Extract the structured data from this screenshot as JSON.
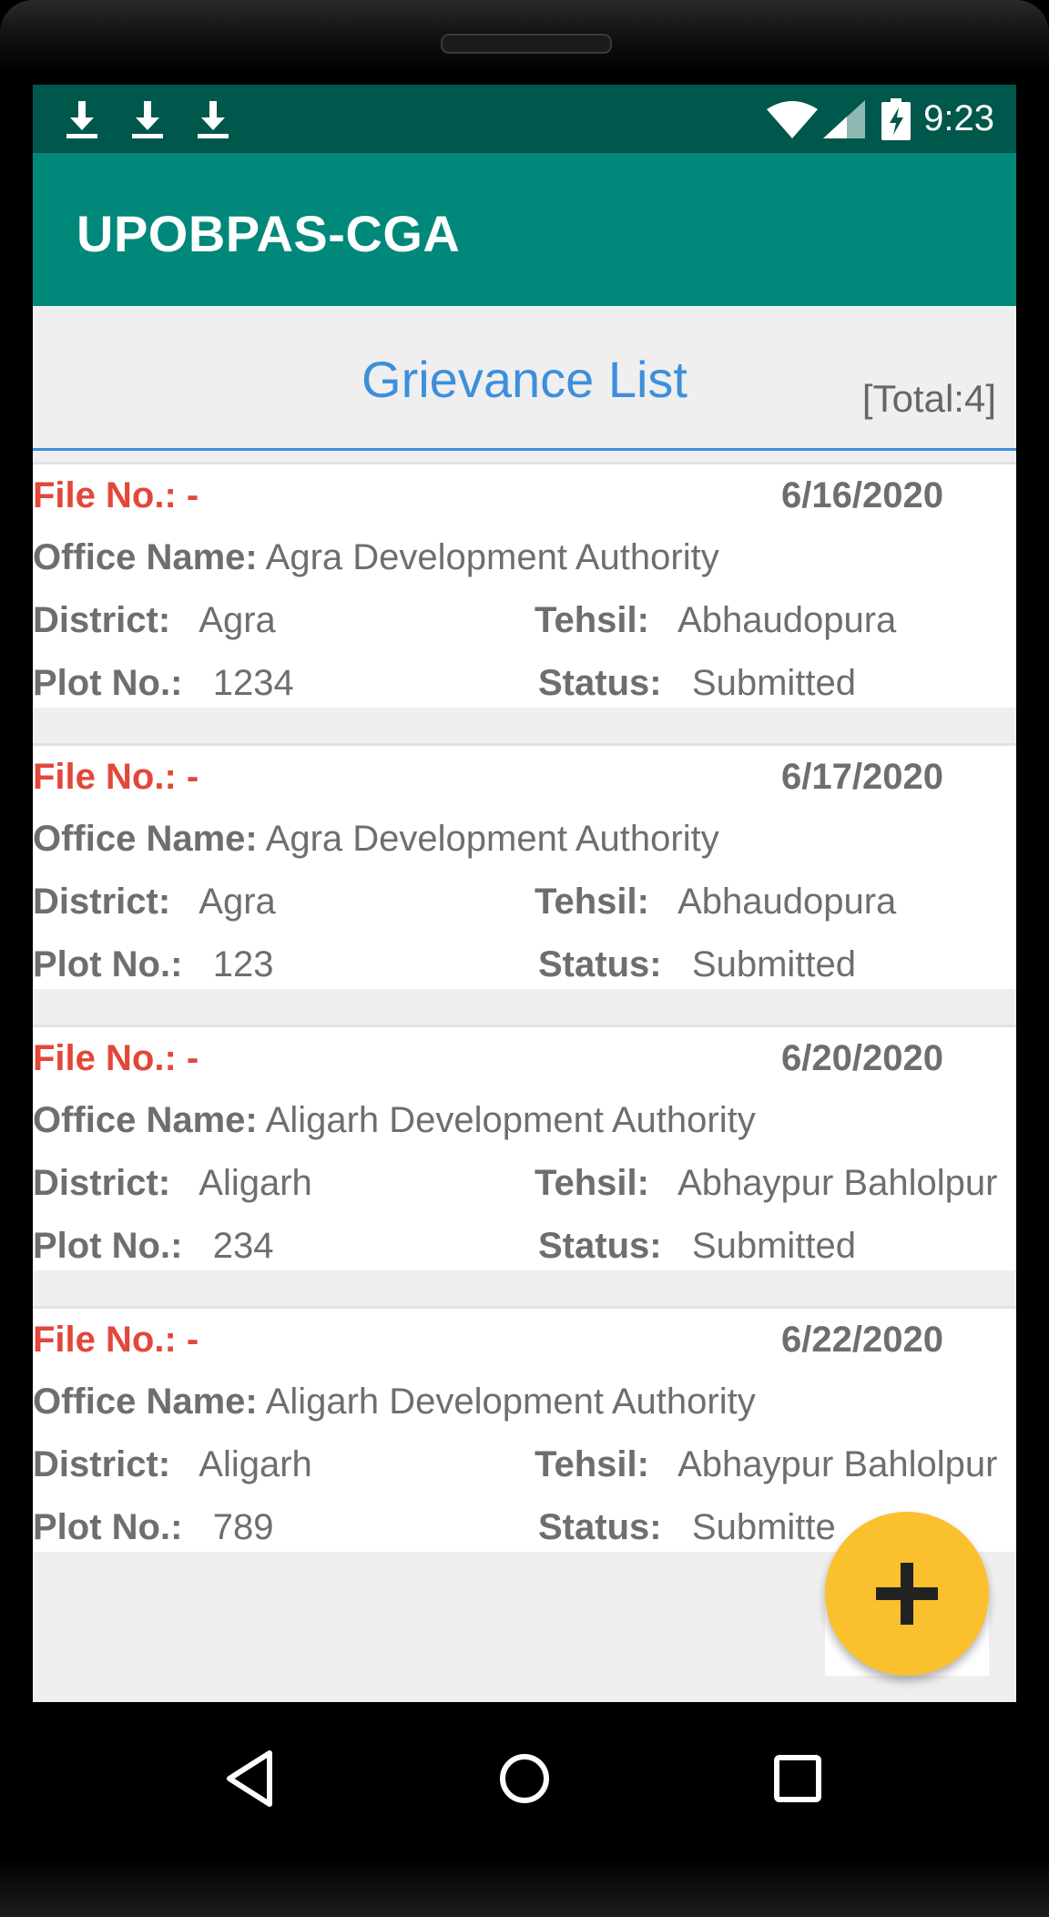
{
  "status_bar": {
    "time": "9:23",
    "icons": [
      "download-icon",
      "download-icon",
      "download-icon",
      "wifi-icon",
      "signal-icon",
      "battery-charging-icon"
    ]
  },
  "app_bar": {
    "title": "UPOBPAS-CGA"
  },
  "header": {
    "title": "Grievance List",
    "total": "[Total:4]"
  },
  "labels": {
    "file_no": "File No.:",
    "office_name": "Office Name:",
    "district": "District:",
    "tehsil": "Tehsil:",
    "plot_no": "Plot No.:",
    "status": "Status:"
  },
  "grievances": [
    {
      "file_no": "-",
      "date": "6/16/2020",
      "office_name": "Agra Development Authority",
      "district": "Agra",
      "tehsil": "Abhaudopura",
      "plot_no": "1234",
      "status": "Submitted"
    },
    {
      "file_no": "-",
      "date": "6/17/2020",
      "office_name": "Agra Development Authority",
      "district": "Agra",
      "tehsil": "Abhaudopura",
      "plot_no": "123",
      "status": "Submitted"
    },
    {
      "file_no": "-",
      "date": "6/20/2020",
      "office_name": "Aligarh Development Authority",
      "district": "Aligarh",
      "tehsil": "Abhaypur Bahlolpur",
      "plot_no": "234",
      "status": "Submitted"
    },
    {
      "file_no": "-",
      "date": "6/22/2020",
      "office_name": "Aligarh Development Authority",
      "district": "Aligarh",
      "tehsil": "Abhaypur Bahlolpur",
      "plot_no": "789",
      "status": "Submitte"
    }
  ],
  "fab": {
    "icon": "plus-icon"
  },
  "nav_bar": {
    "icons": [
      "back-icon",
      "home-icon",
      "recents-icon"
    ]
  },
  "colors": {
    "status_bar": "#00574b",
    "app_bar": "#00887a",
    "accent_blue": "#3d8fdb",
    "file_no_red": "#e2473a",
    "fab_yellow": "#fbc02d"
  }
}
